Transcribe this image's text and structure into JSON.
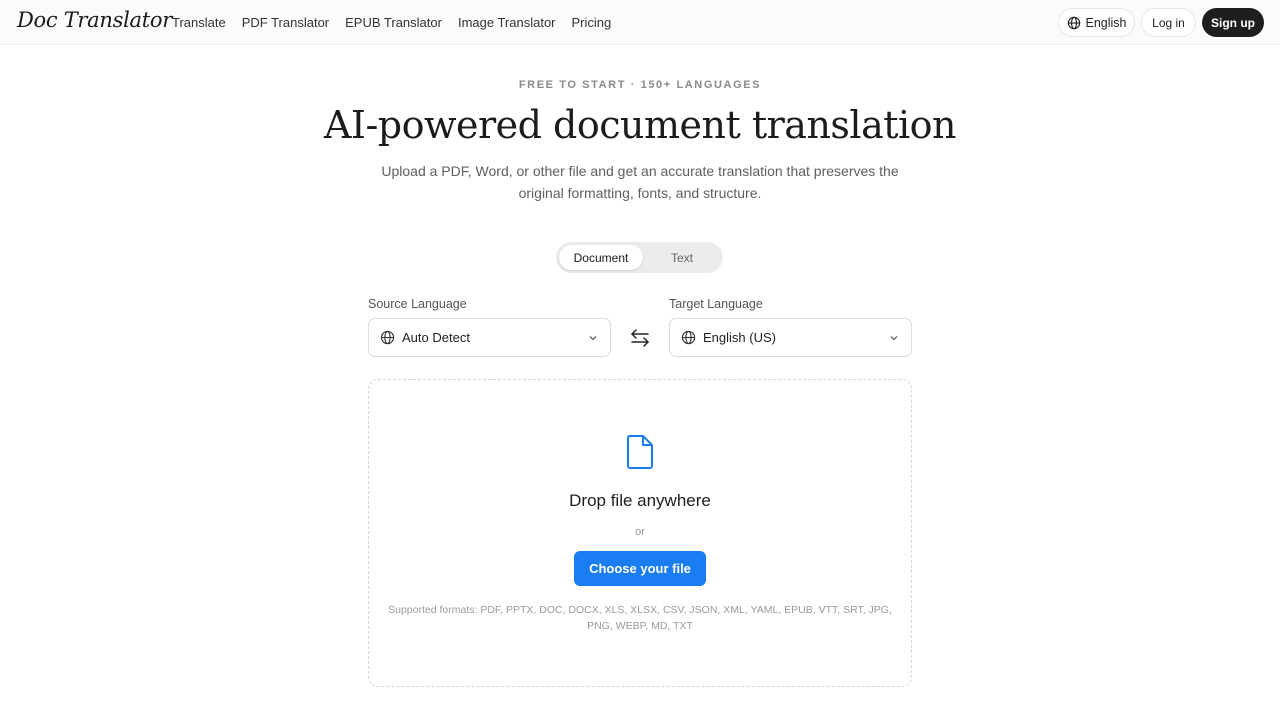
{
  "header": {
    "logo": "Doc Translator",
    "nav": [
      "Translate",
      "PDF Translator",
      "EPUB Translator",
      "Image Translator",
      "Pricing"
    ],
    "language": "English",
    "login": "Log in",
    "signup": "Sign up"
  },
  "hero": {
    "eyebrow": "FREE TO START · 150+ LANGUAGES",
    "title": "AI-powered document translation",
    "subtitle": "Upload a PDF, Word, or other file and get an accurate translation that preserves the original formatting, fonts, and structure."
  },
  "mode_toggle": {
    "selected": "Document",
    "options": [
      "Document",
      "Text"
    ]
  },
  "source": {
    "label": "Source Language",
    "value": "Auto Detect"
  },
  "target": {
    "label": "Target Language",
    "value": "English (US)"
  },
  "dropzone": {
    "title": "Drop file anywhere",
    "or": "or",
    "button": "Choose your file",
    "formats": "Supported formats: PDF, PPTX, DOC, DOCX, XLS, XLSX, CSV, JSON, XML, YAML, EPUB, VTT, SRT, JPG, PNG, WEBP, MD, TXT"
  },
  "colors": {
    "accent": "#1a7ef2",
    "dark_button": "#1e1e1e"
  }
}
